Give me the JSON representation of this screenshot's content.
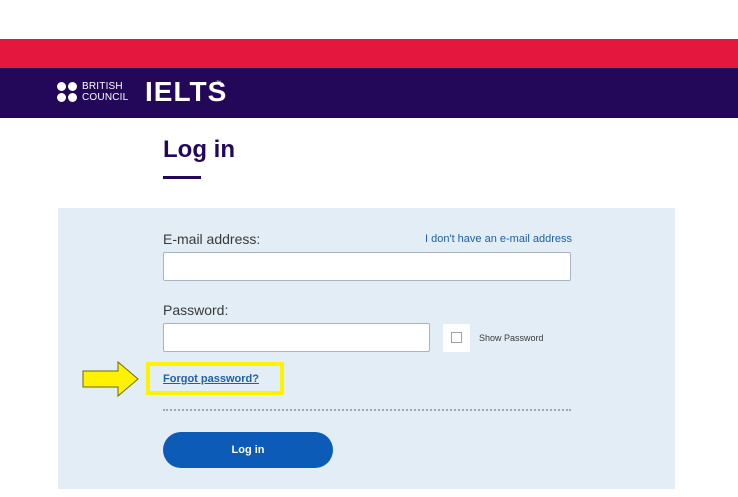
{
  "brand": {
    "council_line1": "BRITISH",
    "council_line2": "COUNCIL",
    "product": "IELTS",
    "trademark": "™"
  },
  "page": {
    "title": "Log in"
  },
  "form": {
    "email_label": "E-mail address:",
    "no_email_link": "I don't have an e-mail address",
    "email_value": "",
    "password_label": "Password:",
    "password_value": "",
    "show_password_label": "Show Password",
    "show_password_checked": false,
    "forgot_password_link": "Forgot password?",
    "submit_label": "Log in"
  },
  "colors": {
    "top_band": "#e4173e",
    "brand_bar": "#23085a",
    "panel_bg": "#e3edf5",
    "primary_button": "#0b5bb7",
    "link": "#1f5fa8",
    "highlight": "#fff200"
  }
}
